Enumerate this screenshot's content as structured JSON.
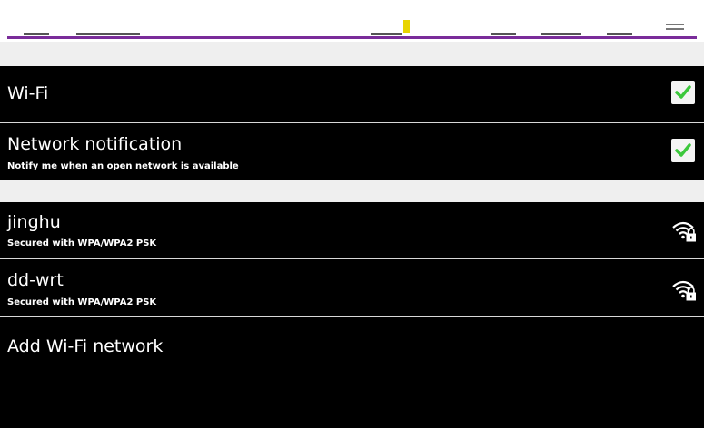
{
  "settings": {
    "wifi": {
      "label": "Wi-Fi",
      "checked": true
    },
    "notification": {
      "label": "Network notification",
      "summary": "Notify me when an open network is available",
      "checked": true
    }
  },
  "networks": [
    {
      "ssid": "jinghu",
      "security": "Secured with WPA/WPA2 PSK",
      "icon": "wifi-lock-icon"
    },
    {
      "ssid": "dd-wrt",
      "security": "Secured with WPA/WPA2 PSK",
      "icon": "wifi-lock-icon"
    }
  ],
  "add_network": {
    "label": "Add Wi-Fi network"
  },
  "colors": {
    "accent": "#7a2c9a",
    "check": "#3cc83c",
    "indicator": "#e8d400"
  }
}
